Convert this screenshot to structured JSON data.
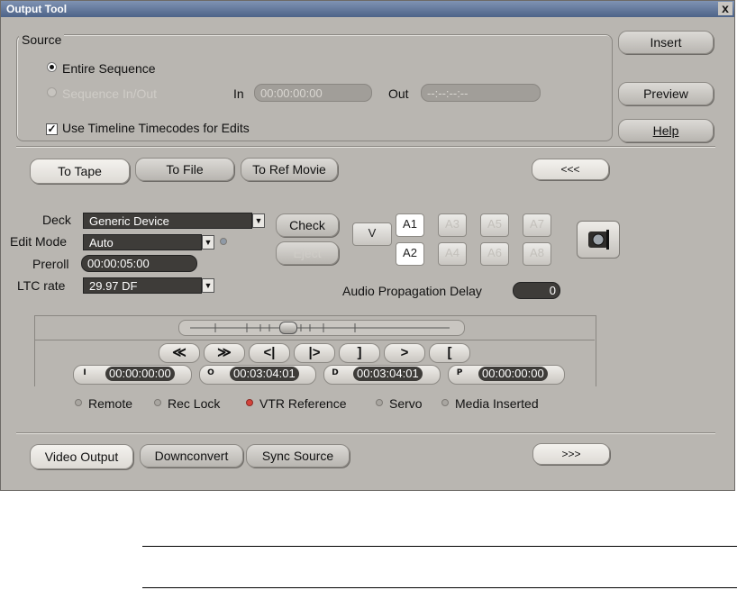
{
  "window": {
    "title": "Output Tool",
    "close_glyph": "x"
  },
  "source": {
    "group_label": "Source",
    "radio_entire": "Entire Sequence",
    "radio_inout": "Sequence In/Out",
    "in_label": "In",
    "in_value": "00:00:00:00",
    "out_label": "Out",
    "out_value": "--:--:--:--",
    "use_timeline_tc": "Use Timeline Timecodes for Edits"
  },
  "side_buttons": {
    "insert": "Insert",
    "preview": "Preview",
    "help": "Help"
  },
  "output_tabs": {
    "to_tape": "To Tape",
    "to_file": "To File",
    "to_ref_movie": "To Ref Movie",
    "collapse": "<<<"
  },
  "deck": {
    "deck_label": "Deck",
    "deck_value": "Generic Device",
    "edit_mode_label": "Edit Mode",
    "edit_mode_value": "Auto",
    "preroll_label": "Preroll",
    "preroll_value": "00:00:05:00",
    "ltc_label": "LTC rate",
    "ltc_value": "29.97 DF",
    "check": "Check",
    "eject": "Eject"
  },
  "tracks": {
    "video": "V",
    "audio": [
      "A1",
      "A3",
      "A5",
      "A7",
      "A2",
      "A4",
      "A6",
      "A8"
    ]
  },
  "audio_delay": {
    "label": "Audio Propagation Delay",
    "value": "0"
  },
  "transport": {
    "buttons": [
      "≪",
      "≫",
      "<|",
      "|>",
      "]",
      ">",
      "["
    ]
  },
  "timecodes": {
    "i_label": "I",
    "i_value": "00:00:00:00",
    "o_label": "O",
    "o_value": "00:03:04:01",
    "d_label": "D",
    "d_value": "00:03:04:01",
    "p_label": "P",
    "p_value": "00:00:00:00"
  },
  "status": {
    "remote": "Remote",
    "rec_lock": "Rec Lock",
    "vtr_reference": "VTR Reference",
    "servo": "Servo",
    "media_inserted": "Media Inserted"
  },
  "bottom_tabs": {
    "video_output": "Video Output",
    "downconvert": "Downconvert",
    "sync_source": "Sync Source",
    "expand": ">>>"
  },
  "colors": {
    "window_bg": "#b9b6b1",
    "titlebar": "#4d6388",
    "field_bg": "#3e3c39",
    "led_active": "#d4433b"
  }
}
